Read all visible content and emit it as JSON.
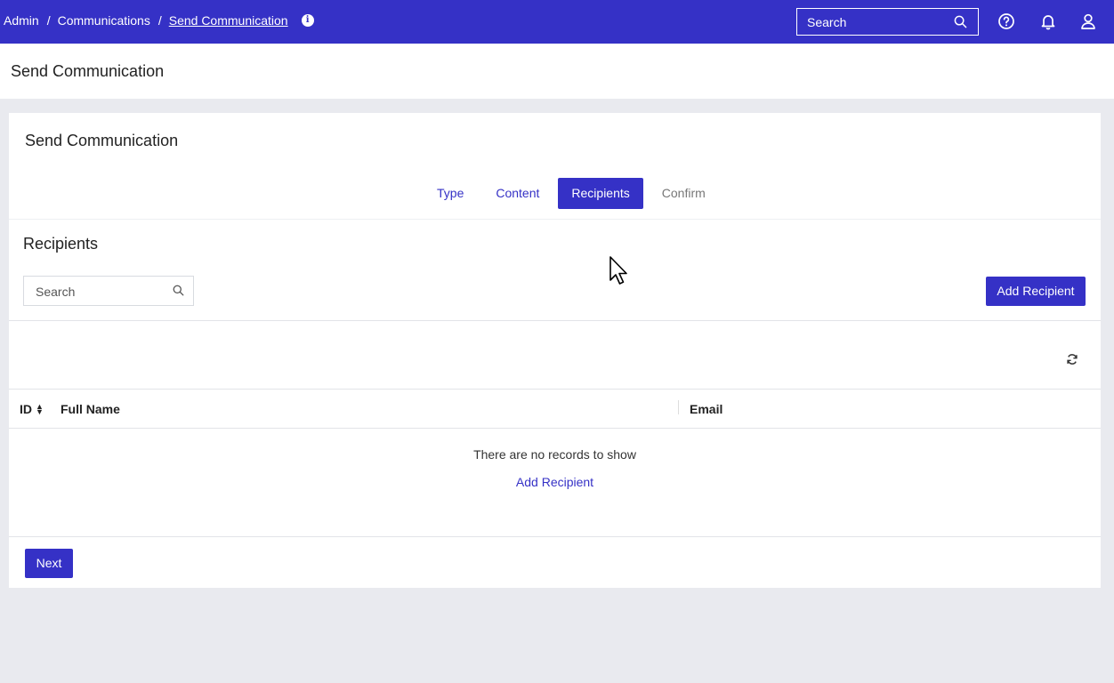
{
  "colors": {
    "brand": "#3531c6",
    "background": "#e9eaef",
    "card": "#ffffff"
  },
  "topbar": {
    "breadcrumbs": [
      "Admin",
      "Communications",
      "Send Communication"
    ],
    "separator": "/",
    "info_icon": "info-icon",
    "search_placeholder": "Search",
    "icons": [
      "help-icon",
      "bell-icon",
      "user-icon"
    ]
  },
  "page": {
    "title": "Send Communication"
  },
  "card": {
    "title": "Send Communication",
    "steps": [
      {
        "label": "Type",
        "state": "done"
      },
      {
        "label": "Content",
        "state": "done"
      },
      {
        "label": "Recipients",
        "state": "active"
      },
      {
        "label": "Confirm",
        "state": "pending"
      }
    ]
  },
  "recipients": {
    "title": "Recipients",
    "search_placeholder": "Search",
    "add_button": "Add Recipient",
    "table": {
      "columns": [
        "ID",
        "Full Name",
        "Email"
      ],
      "rows": [],
      "empty_text": "There are no records to show",
      "empty_action": "Add Recipient"
    }
  },
  "footer": {
    "next_button": "Next"
  }
}
